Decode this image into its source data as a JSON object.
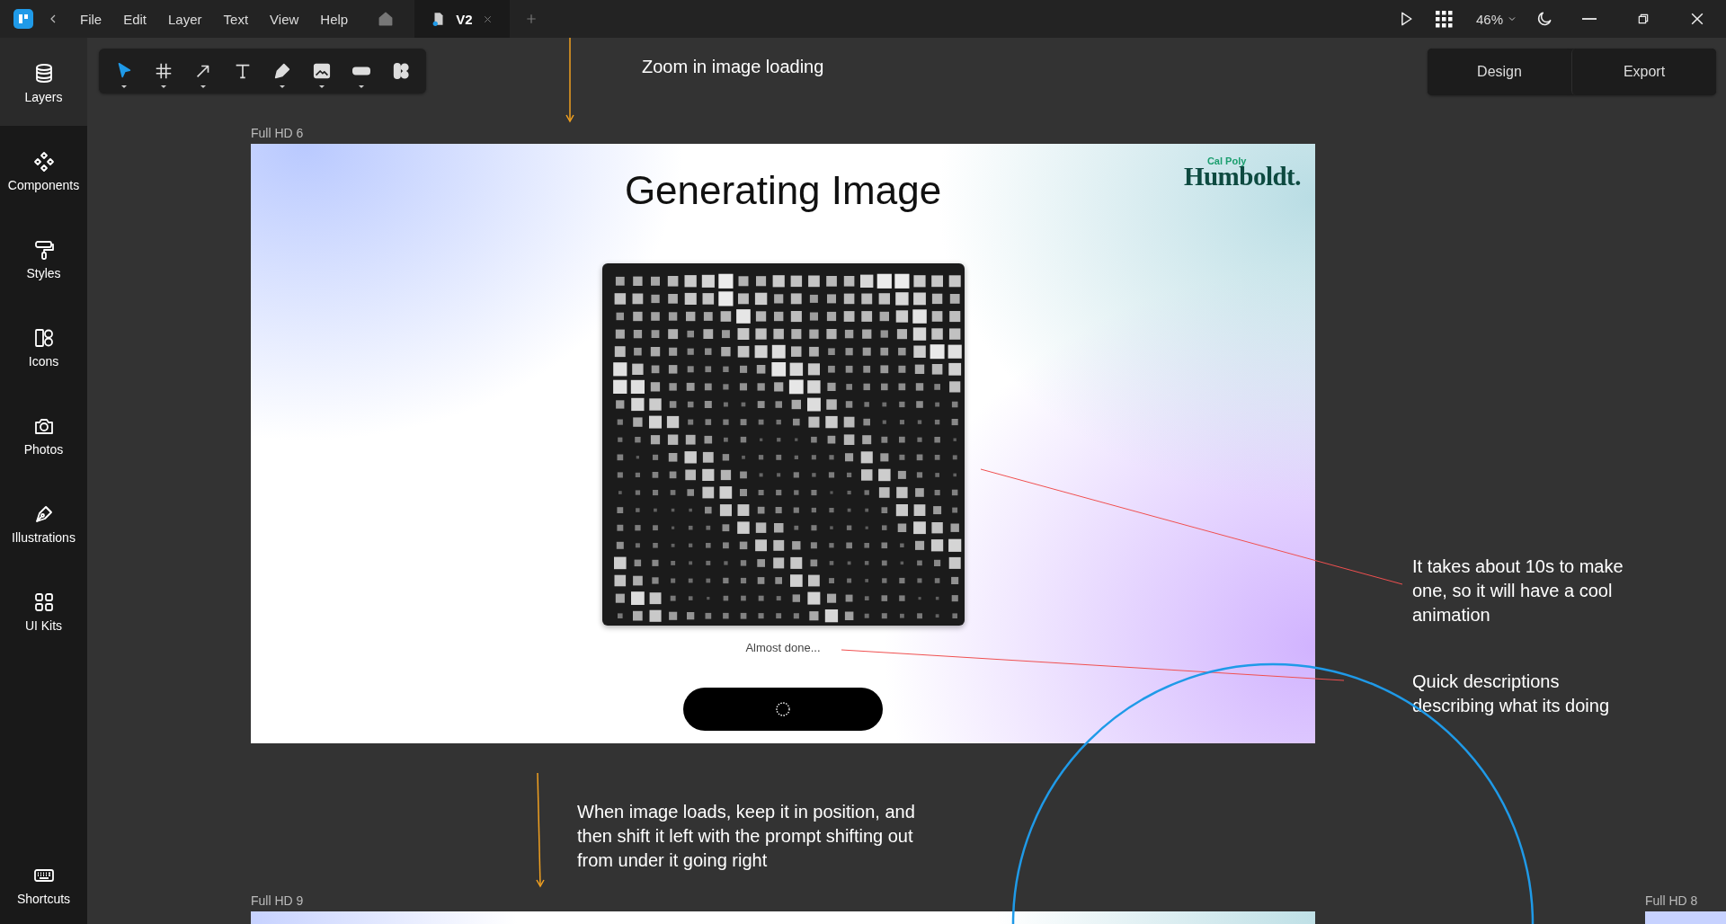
{
  "topbar": {
    "menu": [
      "File",
      "Edit",
      "Layer",
      "Text",
      "View",
      "Help"
    ],
    "tabs": [
      {
        "label": "V2",
        "selected": true
      }
    ],
    "zoom": "46%"
  },
  "sidebar": {
    "items": [
      {
        "label": "Layers",
        "kind": "layers",
        "selected": true
      },
      {
        "label": "Components",
        "kind": "components",
        "selected": false
      },
      {
        "label": "Styles",
        "kind": "styles",
        "selected": false
      },
      {
        "label": "Icons",
        "kind": "icons",
        "selected": false
      },
      {
        "label": "Photos",
        "kind": "photos",
        "selected": false
      },
      {
        "label": "Illustrations",
        "kind": "illustrations",
        "selected": false
      },
      {
        "label": "UI Kits",
        "kind": "uikits",
        "selected": false
      }
    ],
    "footer": "Shortcuts"
  },
  "toolbar": {
    "tools": [
      {
        "kind": "select",
        "selected": true,
        "dropdown": true
      },
      {
        "kind": "frame",
        "selected": false,
        "dropdown": true
      },
      {
        "kind": "arrow",
        "selected": false,
        "dropdown": true
      },
      {
        "kind": "text",
        "selected": false,
        "dropdown": false
      },
      {
        "kind": "pen",
        "selected": false,
        "dropdown": true
      },
      {
        "kind": "image",
        "selected": false,
        "dropdown": true
      },
      {
        "kind": "shape",
        "selected": false,
        "dropdown": true
      },
      {
        "kind": "components",
        "selected": false,
        "dropdown": false
      }
    ]
  },
  "mode_tabs": [
    "Design",
    "Export"
  ],
  "canvas": {
    "notes": [
      "Zoom in image loading",
      "It takes about 10s to make\none, so it will have a cool\nanimation",
      "Quick descriptions\ndescribing what its doing",
      "When image loads, keep it in position, and\nthen shift it left with the prompt shifting out\nfrom under it going right"
    ],
    "frame": {
      "label": "Full HD 6",
      "title": "Generating Image",
      "logo": {
        "small": "Cal Poly",
        "large": "Humboldt."
      },
      "status": "Almost done...",
      "button": {
        "loading": true
      }
    },
    "other_frames": [
      "Full HD 9",
      "Full HD 8"
    ]
  }
}
